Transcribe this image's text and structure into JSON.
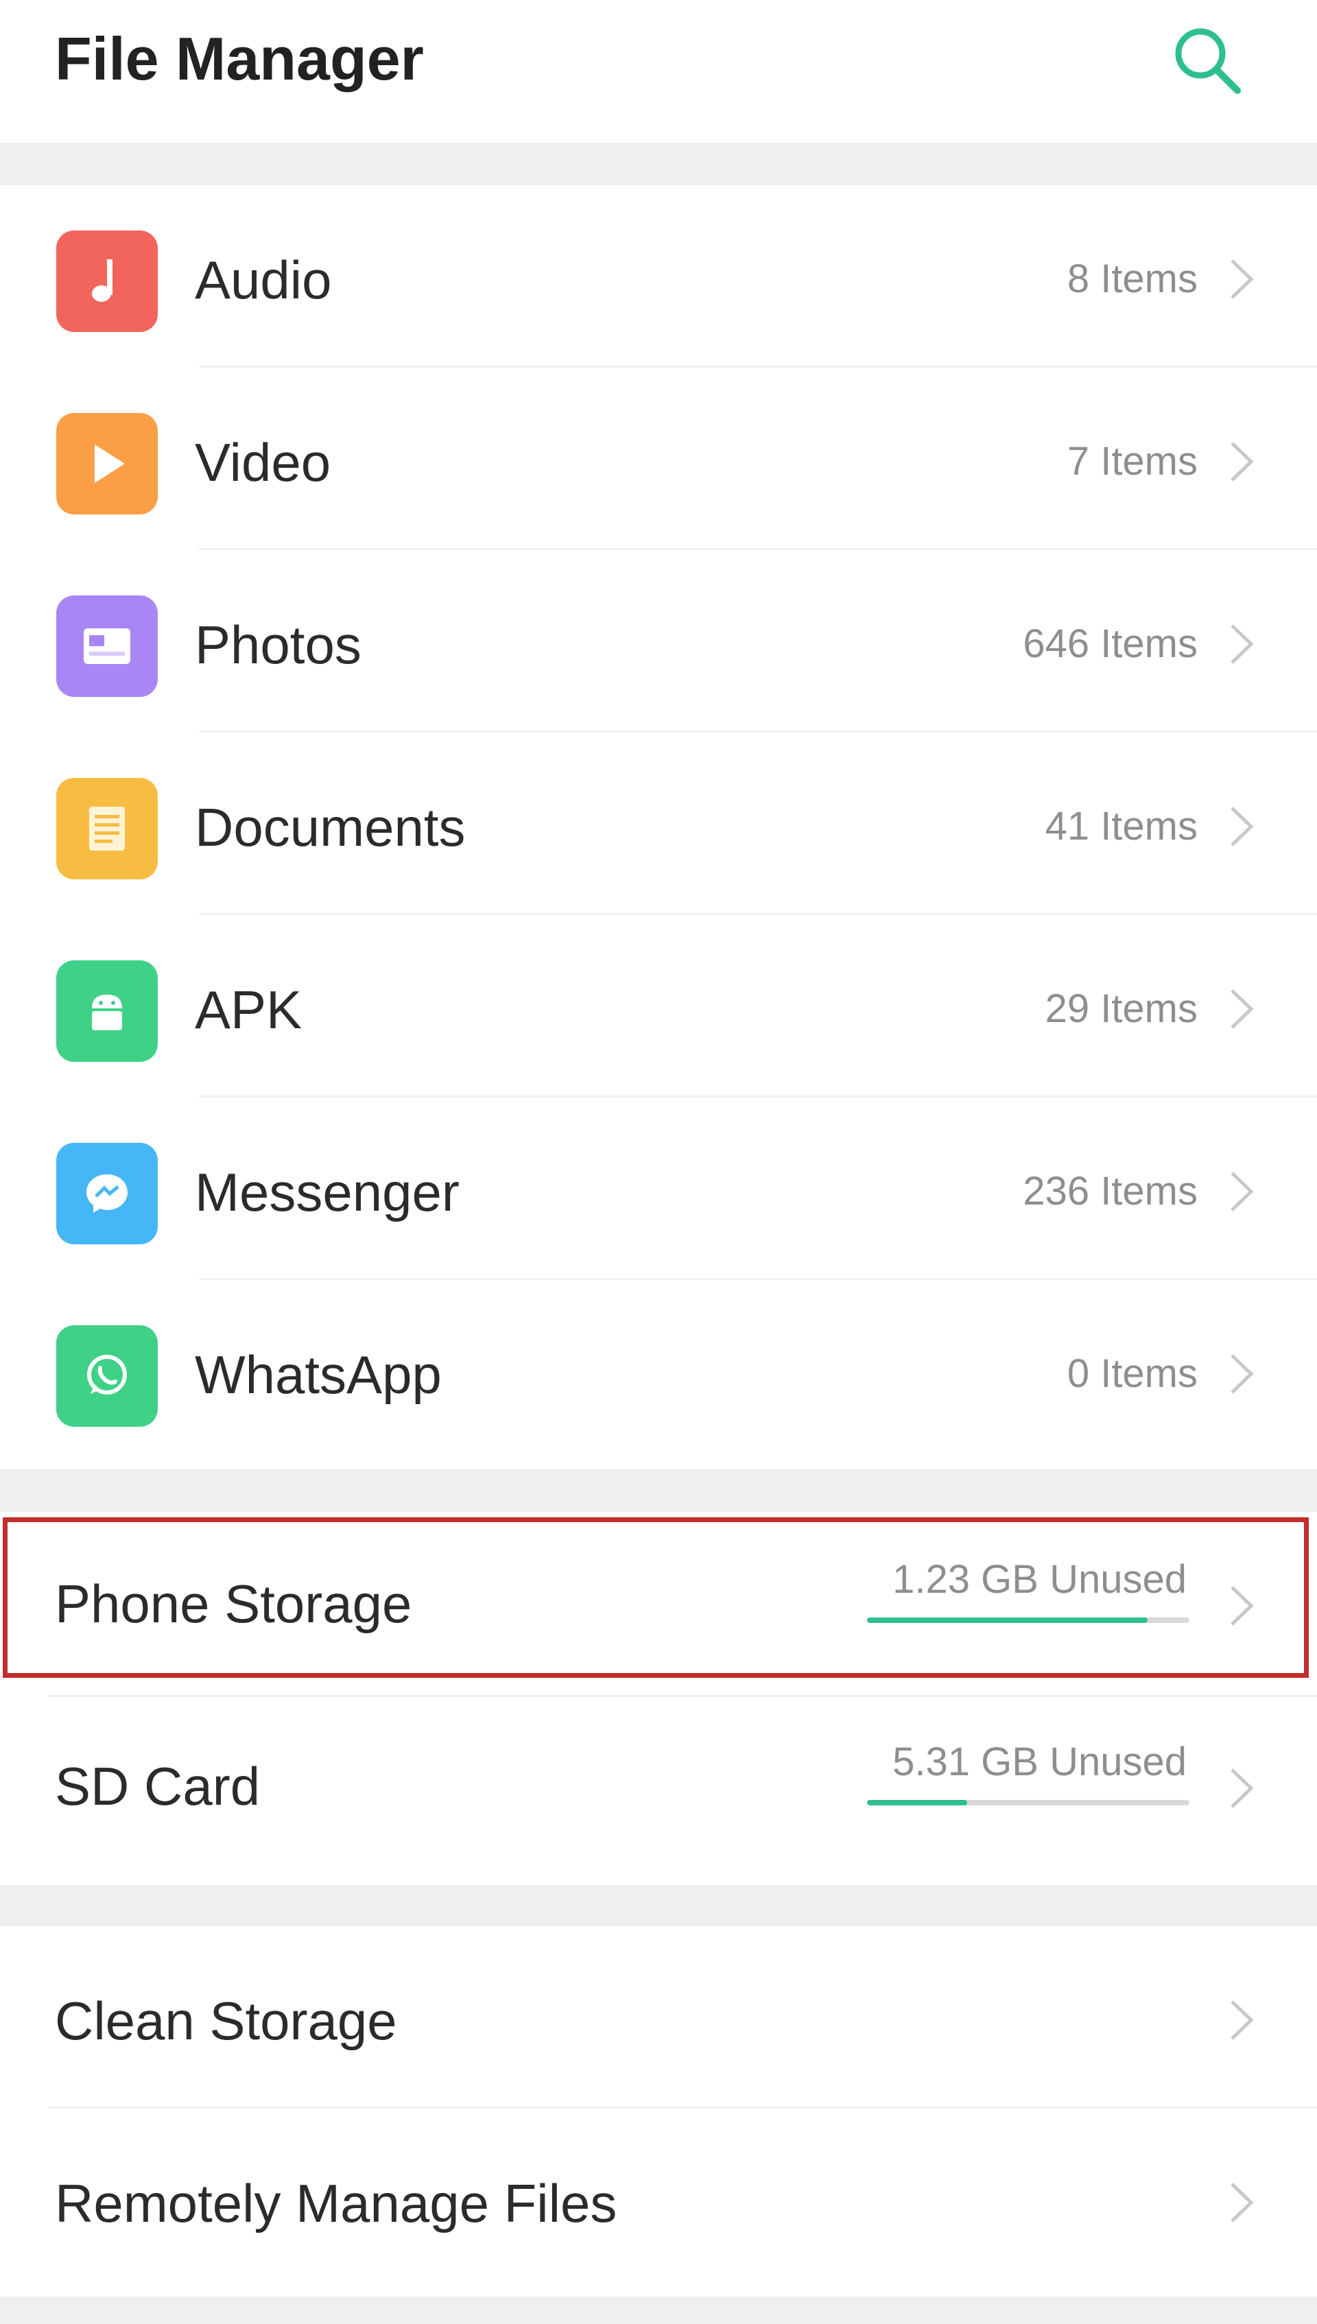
{
  "header": {
    "title": "File Manager",
    "search_icon": "search-icon",
    "accent_color": "#2fbf8c"
  },
  "categories": [
    {
      "label": "Audio",
      "count": "8 Items",
      "icon": "music-note-icon",
      "color": "#f2655d"
    },
    {
      "label": "Video",
      "count": "7 Items",
      "icon": "play-icon",
      "color": "#fb9f47"
    },
    {
      "label": "Photos",
      "count": "646 Items",
      "icon": "image-icon",
      "color": "#a986f5"
    },
    {
      "label": "Documents",
      "count": "41 Items",
      "icon": "document-icon",
      "color": "#f7bd43"
    },
    {
      "label": "APK",
      "count": "29 Items",
      "icon": "android-icon",
      "color": "#3fd187"
    },
    {
      "label": "Messenger",
      "count": "236 Items",
      "icon": "messenger-icon",
      "color": "#45b6f6"
    },
    {
      "label": "WhatsApp",
      "count": "0 Items",
      "icon": "whatsapp-icon",
      "color": "#3fd187"
    }
  ],
  "storage": [
    {
      "label": "Phone Storage",
      "unused": "1.23 GB Unused",
      "used_fraction": 0.87,
      "highlighted": true
    },
    {
      "label": "SD Card",
      "unused": "5.31 GB Unused",
      "used_fraction": 0.31,
      "highlighted": false
    }
  ],
  "tools": [
    {
      "label": "Clean Storage"
    },
    {
      "label": "Remotely Manage Files"
    }
  ]
}
